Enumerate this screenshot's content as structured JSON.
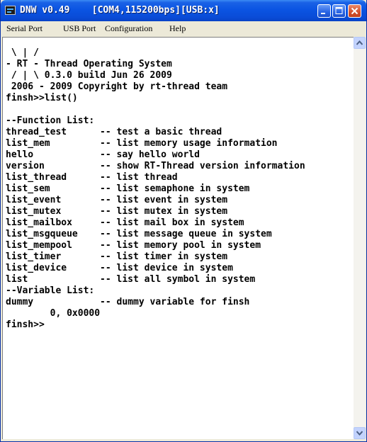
{
  "window": {
    "title": "DNW v0.49    [COM4,115200bps][USB:x]",
    "app_icon": "terminal-app-icon",
    "controls": [
      "minimize-icon",
      "maximize-icon",
      "close-icon"
    ]
  },
  "menu": {
    "items": [
      {
        "label": "Serial Port"
      },
      {
        "label": "USB Port"
      },
      {
        "label": "Configuration"
      },
      {
        "label": "Help"
      }
    ]
  },
  "terminal": {
    "lines": [
      " \\ | /",
      "- RT - Thread Operating System",
      " / | \\ 0.3.0 build Jun 26 2009",
      " 2006 - 2009 Copyright by rt-thread team",
      "finsh>>list()",
      "",
      "--Function List:",
      "thread_test      -- test a basic thread",
      "list_mem         -- list memory usage information",
      "hello            -- say hello world",
      "version          -- show RT-Thread version information",
      "list_thread      -- list thread",
      "list_sem         -- list semaphone in system",
      "list_event       -- list event in system",
      "list_mutex       -- list mutex in system",
      "list_mailbox     -- list mail box in system",
      "list_msgqueue    -- list message queue in system",
      "list_mempool     -- list memory pool in system",
      "list_timer       -- list timer in system",
      "list_device      -- list device in system",
      "list             -- list all symbol in system",
      "--Variable List:",
      "dummy            -- dummy variable for finsh",
      "        0, 0x0000",
      "finsh>>"
    ]
  },
  "colors": {
    "titlebar": "#0b54e2",
    "terminal_bg": "#ffffff",
    "terminal_fg": "#000000"
  }
}
